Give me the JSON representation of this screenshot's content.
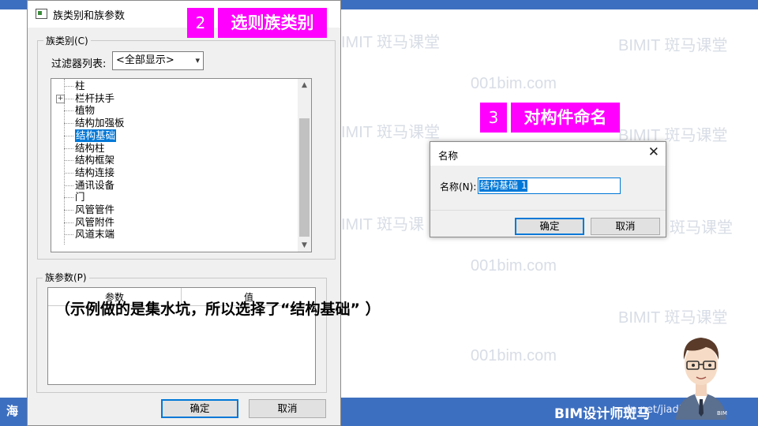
{
  "watermarks": {
    "brand": "BIMIT 斑马课堂",
    "brand_cut": "IMIT 斑马课堂",
    "brand_cut2": "IMIT 斑马课",
    "site": "001bim.com"
  },
  "footer": {
    "left": "海",
    "right": "BIM设计师斑马",
    "url": "dn.net/jiadianxin"
  },
  "main_dialog": {
    "title": "族类别和族参数",
    "category_group": "族类别(C)",
    "filter_label": "过滤器列表:",
    "filter_value": "<全部显示>",
    "tree_items": [
      "柱",
      "栏杆扶手",
      "植物",
      "结构加强板",
      "结构基础",
      "结构柱",
      "结构框架",
      "结构连接",
      "通讯设备",
      "门",
      "风管管件",
      "风管附件",
      "风道末端"
    ],
    "expander_symbol": "+",
    "selected_item": "结构基础",
    "param_group": "族参数(P)",
    "param_headers": [
      "参数",
      "值"
    ],
    "ok_button": "确定",
    "cancel_button": "取消"
  },
  "steps": {
    "step2_num": "2",
    "step2_text": "选则族类别",
    "step3_num": "3",
    "step3_text": "对构件命名"
  },
  "note": "（示例做的是集水坑，所以选择了“结构基础” ）",
  "name_dialog": {
    "title": "名称",
    "label": "名称(N):",
    "value": "结构基础 1",
    "ok_button": "确定",
    "cancel_button": "取消",
    "close_symbol": "✕"
  },
  "avatar_badge": "BIM",
  "colors": {
    "accent_bar": "#3d6fc0",
    "step_badge": "#ff00ff",
    "selection": "#0078d7"
  }
}
